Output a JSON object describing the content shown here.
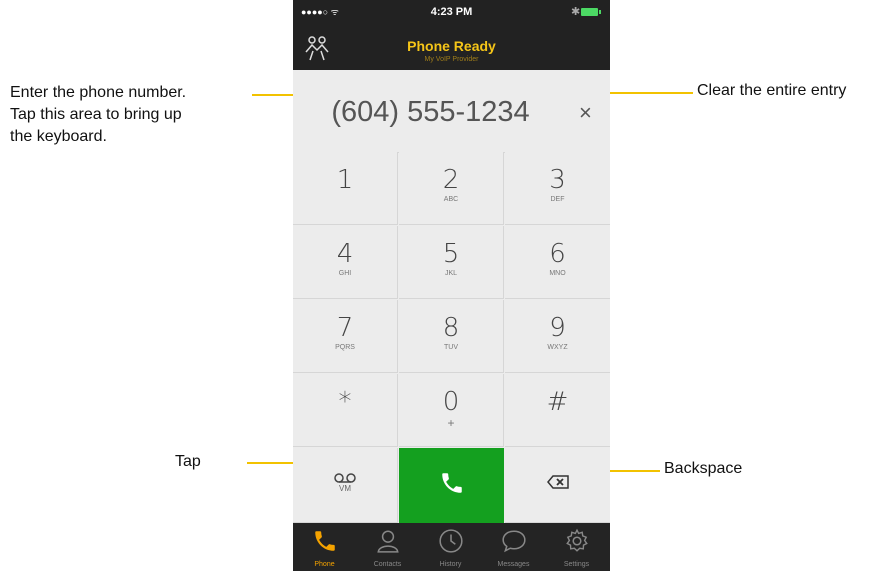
{
  "callouts": {
    "enter_number": [
      "Enter the phone number.",
      "Tap this area to bring up",
      "the keyboard."
    ],
    "clear_entry": "Clear the entire entry",
    "tap": "Tap",
    "backspace": "Backspace"
  },
  "status_bar": {
    "signal": "●●●●○ ᯤ",
    "time": "4:23 PM",
    "bluetooth": "✱"
  },
  "app_bar": {
    "title": "Phone Ready",
    "subtitle": "My VoIP Provider",
    "logo_icon": "people-icon"
  },
  "dial": {
    "number": "(604) 555-1234",
    "clear_symbol": "×"
  },
  "keypad": {
    "keys": [
      {
        "digit": "1",
        "letters": ""
      },
      {
        "digit": "2",
        "letters": "ABC"
      },
      {
        "digit": "3",
        "letters": "DEF"
      },
      {
        "digit": "4",
        "letters": "GHI"
      },
      {
        "digit": "5",
        "letters": "JKL"
      },
      {
        "digit": "6",
        "letters": "MNO"
      },
      {
        "digit": "7",
        "letters": "PQRS"
      },
      {
        "digit": "8",
        "letters": "TUV"
      },
      {
        "digit": "9",
        "letters": "WXYZ"
      },
      {
        "digit": "*",
        "letters": ""
      },
      {
        "digit": "0",
        "letters": "+"
      },
      {
        "digit": "#",
        "letters": ""
      }
    ],
    "voicemail_label": "VM",
    "call_icon": "phone-icon",
    "backspace_icon": "backspace-icon"
  },
  "tabs": [
    {
      "label": "Phone",
      "icon": "phone-icon",
      "active": true
    },
    {
      "label": "Contacts",
      "icon": "contacts-icon",
      "active": false
    },
    {
      "label": "History",
      "icon": "clock-icon",
      "active": false
    },
    {
      "label": "Messages",
      "icon": "chat-bubble-icon",
      "active": false
    },
    {
      "label": "Settings",
      "icon": "gear-icon",
      "active": false
    }
  ],
  "colors": {
    "accent": "#f5c518",
    "call_button": "#14a01f",
    "callout_line": "#f2c200",
    "bar_background": "#222222"
  }
}
